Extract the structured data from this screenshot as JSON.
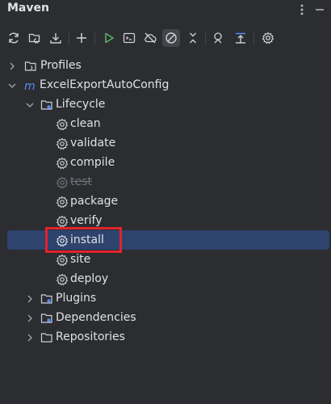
{
  "panel": {
    "title": "Maven"
  },
  "header_buttons": [
    {
      "icon": "more-options-icon"
    },
    {
      "icon": "minimize-icon"
    }
  ],
  "toolbar": [
    {
      "icon": "reload-icon"
    },
    {
      "icon": "generate-sources-icon"
    },
    {
      "icon": "download-icon"
    },
    {
      "icon": "add-icon"
    },
    {
      "icon": "run-icon"
    },
    {
      "icon": "execute-goal-icon"
    },
    {
      "icon": "toggle-offline-icon"
    },
    {
      "icon": "skip-tests-icon"
    },
    {
      "icon": "collapse-icon"
    },
    {
      "icon": "show-dependencies-icon"
    },
    {
      "icon": "analyze-icon"
    },
    {
      "icon": "settings-icon"
    }
  ],
  "tree": {
    "profiles": "Profiles",
    "project": "ExcelExportAutoConfig",
    "lifecycle": "Lifecycle",
    "goals": [
      "clean",
      "validate",
      "compile",
      "test",
      "package",
      "verify",
      "install",
      "site",
      "deploy"
    ],
    "disabled_goal": "test",
    "selected_goal": "install",
    "plugins": "Plugins",
    "dependencies": "Dependencies",
    "repositories": "Repositories"
  },
  "colors": {
    "background": "#2b2d30",
    "selection": "#2e436e",
    "highlight_box": "#e0242b",
    "run_green": "#5fb865",
    "maven_blue": "#548af7"
  }
}
